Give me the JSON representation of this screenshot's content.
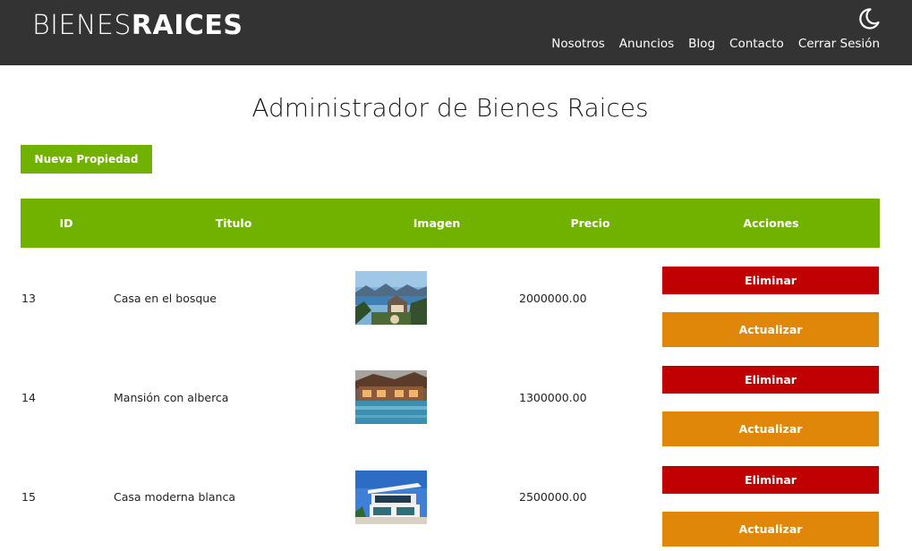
{
  "header": {
    "logo_light": "BIENES",
    "logo_bold": "RAICES",
    "nav": [
      {
        "label": "Nosotros"
      },
      {
        "label": "Anuncios"
      },
      {
        "label": "Blog"
      },
      {
        "label": "Contacto"
      },
      {
        "label": "Cerrar Sesión"
      }
    ],
    "theme_icon": "moon-icon"
  },
  "main": {
    "title": "Administrador de Bienes Raices",
    "new_button": "Nueva Propiedad",
    "table": {
      "columns": [
        "ID",
        "Titulo",
        "Imagen",
        "Precio",
        "Acciones"
      ],
      "rows": [
        {
          "id": "13",
          "title": "Casa en el bosque",
          "image": "forest-house-photo",
          "price": "2000000.00",
          "delete": "Eliminar",
          "update": "Actualizar"
        },
        {
          "id": "14",
          "title": "Mansión con alberca",
          "image": "pool-mansion-photo",
          "price": "1300000.00",
          "delete": "Eliminar",
          "update": "Actualizar"
        },
        {
          "id": "15",
          "title": "Casa moderna blanca",
          "image": "modern-white-house-photo",
          "price": "2500000.00",
          "delete": "Eliminar",
          "update": "Actualizar"
        }
      ]
    }
  },
  "colors": {
    "header_bg": "#333333",
    "accent_green": "#71b100",
    "delete_red": "#c00000",
    "update_orange": "#e08709"
  }
}
